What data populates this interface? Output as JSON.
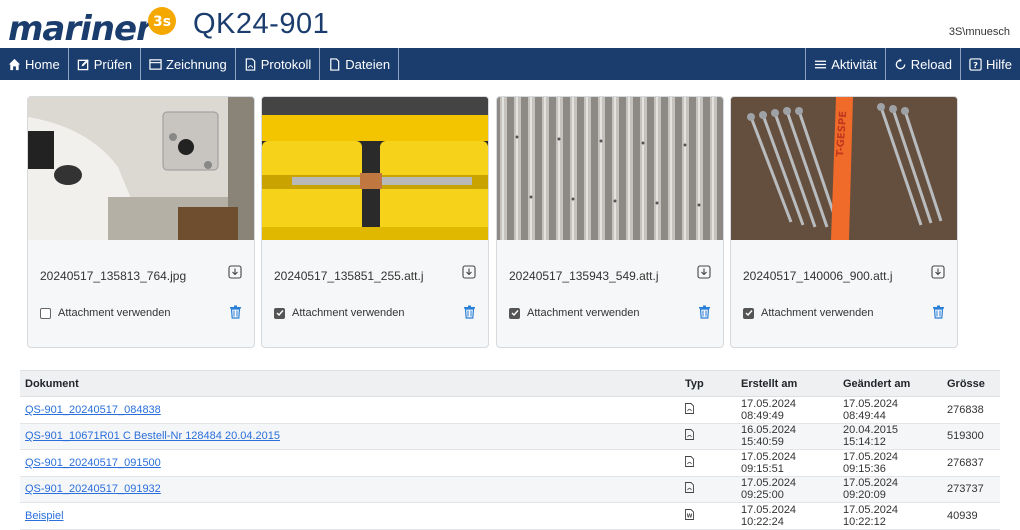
{
  "header": {
    "logo_text": "mariner",
    "logo_badge": "3s",
    "title": "QK24-901",
    "user": "3S\\mnuesch"
  },
  "nav": {
    "left": [
      {
        "label": "Home",
        "icon": "home-icon"
      },
      {
        "label": "Prüfen",
        "icon": "edit-icon"
      },
      {
        "label": "Zeichnung",
        "icon": "drawing-icon"
      },
      {
        "label": "Protokoll",
        "icon": "pdf-file-icon"
      },
      {
        "label": "Dateien",
        "icon": "file-icon"
      }
    ],
    "right": [
      {
        "label": "Aktivität",
        "icon": "menu-icon"
      },
      {
        "label": "Reload",
        "icon": "reload-icon"
      },
      {
        "label": "Hilfe",
        "icon": "help-icon"
      }
    ]
  },
  "attachments": [
    {
      "filename": "20240517_135813_764.jpg",
      "checked": false,
      "check_label": "Attachment verwenden"
    },
    {
      "filename": "20240517_135851_255.att.j",
      "checked": true,
      "check_label": "Attachment verwenden"
    },
    {
      "filename": "20240517_135943_549.att.j",
      "checked": true,
      "check_label": "Attachment verwenden"
    },
    {
      "filename": "20240517_140006_900.att.j",
      "checked": true,
      "check_label": "Attachment verwenden"
    }
  ],
  "documents": {
    "headers": {
      "dokument": "Dokument",
      "typ": "Typ",
      "erstellt": "Erstellt am",
      "geaendert": "Geändert am",
      "groesse": "Grösse"
    },
    "rows": [
      {
        "name": "QS-901_20240517_084838",
        "typ": "pdf",
        "erstellt": "17.05.2024 08:49:49",
        "geaendert": "17.05.2024 08:49:44",
        "groesse": "276838"
      },
      {
        "name": "QS-901_10671R01 C Bestell-Nr 128484 20.04.2015",
        "typ": "pdf",
        "erstellt": "16.05.2024 15:40:59",
        "geaendert": "20.04.2015 15:14:12",
        "groesse": "519300"
      },
      {
        "name": "QS-901_20240517_091500",
        "typ": "pdf",
        "erstellt": "17.05.2024 09:15:51",
        "geaendert": "17.05.2024 09:15:36",
        "groesse": "276837"
      },
      {
        "name": "QS-901_20240517_091932",
        "typ": "pdf",
        "erstellt": "17.05.2024 09:25:00",
        "geaendert": "17.05.2024 09:20:09",
        "groesse": "273737"
      },
      {
        "name": "Beispiel",
        "typ": "word",
        "erstellt": "17.05.2024 10:22:24",
        "geaendert": "17.05.2024 10:22:12",
        "groesse": "40939"
      }
    ]
  },
  "colors": {
    "brand": "#1a3d6e",
    "accent": "#f5a800",
    "link": "#2a6fdb",
    "trash": "#2a7fd6"
  }
}
